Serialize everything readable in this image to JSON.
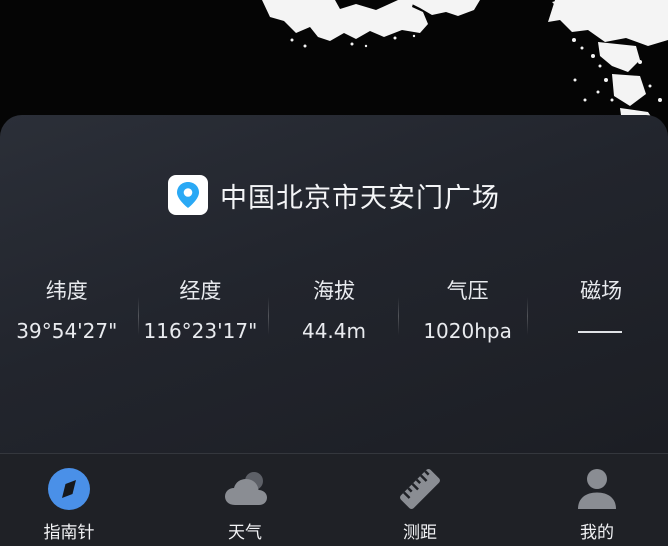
{
  "location": {
    "title": "中国北京市天安门广场",
    "icon": "location-pin-icon",
    "accent": "#2aa9f5"
  },
  "stats": [
    {
      "label": "纬度",
      "value": "39°54'27\""
    },
    {
      "label": "经度",
      "value": "116°23'17\""
    },
    {
      "label": "海拔",
      "value": "44.4m"
    },
    {
      "label": "气压",
      "value": "1020hpa"
    },
    {
      "label": "磁场",
      "value": ""
    }
  ],
  "tabs": [
    {
      "label": "指南针",
      "icon": "compass-icon",
      "active": true
    },
    {
      "label": "天气",
      "icon": "cloud-icon"
    },
    {
      "label": "测距",
      "icon": "ruler-icon"
    },
    {
      "label": "我的",
      "icon": "user-icon"
    }
  ],
  "colors": {
    "tab_active": "#4a90e8",
    "tab_inactive": "#8a8d93"
  }
}
